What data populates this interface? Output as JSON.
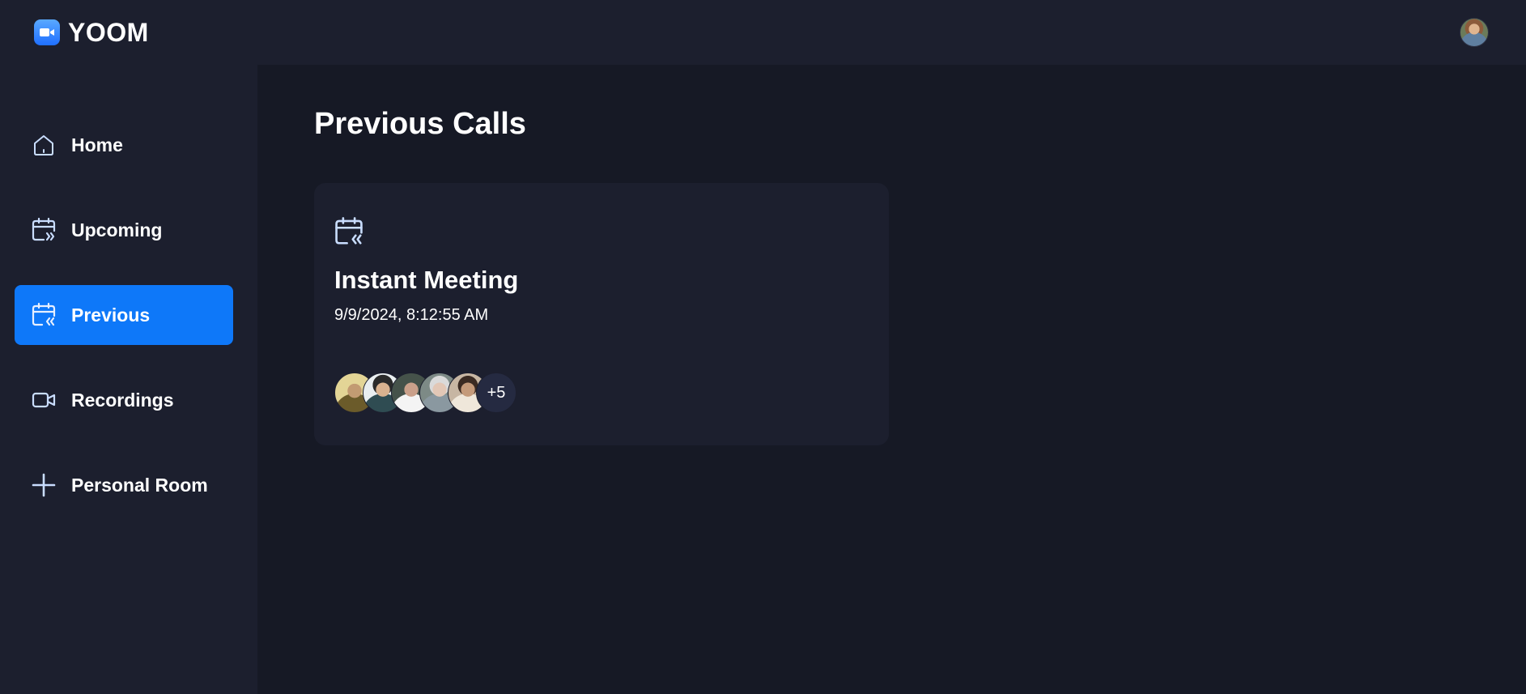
{
  "app": {
    "name": "YOOM"
  },
  "sidebar": {
    "items": [
      {
        "label": "Home",
        "icon": "home-icon",
        "active": false
      },
      {
        "label": "Upcoming",
        "icon": "calendar-upcoming-icon",
        "active": false
      },
      {
        "label": "Previous",
        "icon": "calendar-previous-icon",
        "active": true
      },
      {
        "label": "Recordings",
        "icon": "video-icon",
        "active": false
      },
      {
        "label": "Personal Room",
        "icon": "plus-icon",
        "active": false
      }
    ]
  },
  "main": {
    "title": "Previous Calls",
    "cards": [
      {
        "icon": "calendar-previous-icon",
        "title": "Instant Meeting",
        "date": "9/9/2024, 8:12:55 AM",
        "attendees_more": "+5"
      }
    ]
  },
  "colors": {
    "accent": "#0e78f9",
    "surface": "#1c1f2e",
    "background": "#161925"
  }
}
